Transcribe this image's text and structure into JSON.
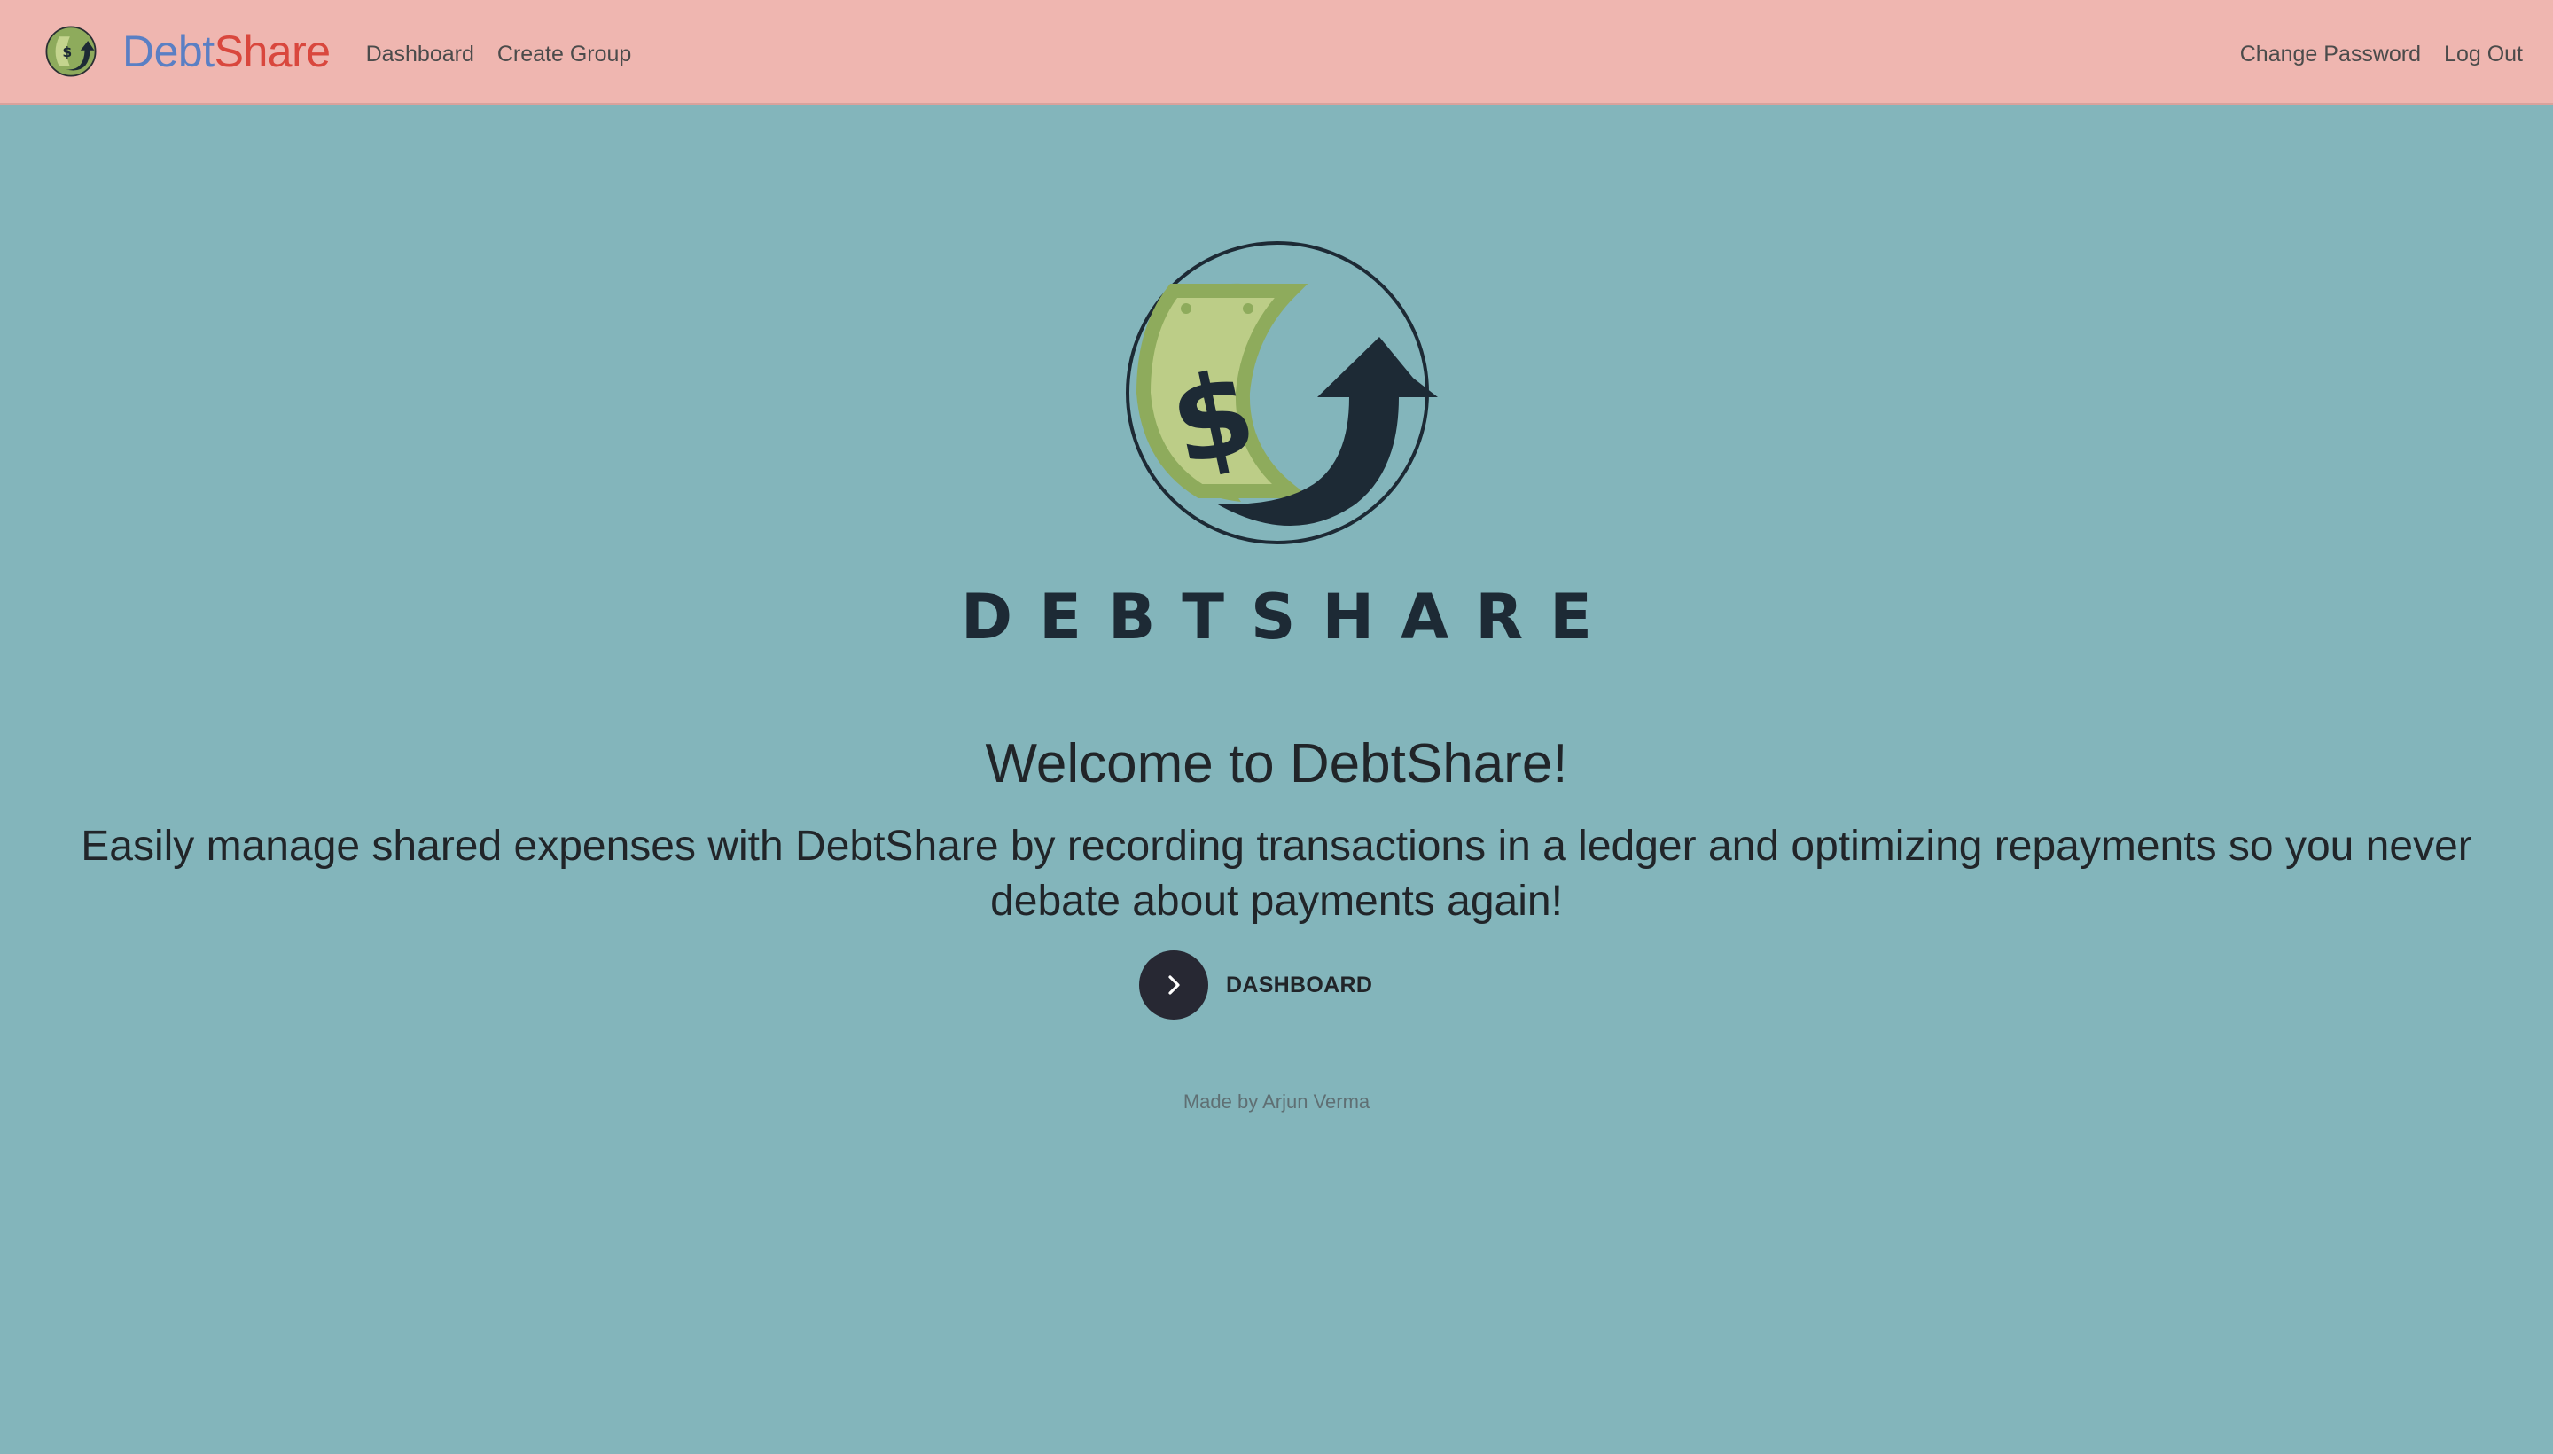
{
  "navbar": {
    "brand_part1": "Debt",
    "brand_part2": "Share",
    "logo_icon": "debtshare-logo-icon",
    "links_left": [
      "Dashboard",
      "Create Group"
    ],
    "links_right": [
      "Change Password",
      "Log Out"
    ],
    "background": "#efb6b0"
  },
  "hero": {
    "logo_icon": "debtshare-money-arrow-logo",
    "wordmark": "DEBTSHARE",
    "welcome": "Welcome to DebtShare!",
    "tagline": "Easily manage shared expenses with DebtShare by recording transactions in a ledger and optimizing repayments so you never debate about payments again!",
    "cta_icon": "chevron-right-icon",
    "cta_label": "DASHBOARD"
  },
  "footer": {
    "credit": "Made by Arjun Verma"
  },
  "colors": {
    "page_background": "#83b5bb",
    "brand_blue": "#5a7fc4",
    "brand_red": "#d9473d",
    "dark": "#1d2a35",
    "bill_green": "#8aa757",
    "bill_light": "#bccd87"
  }
}
